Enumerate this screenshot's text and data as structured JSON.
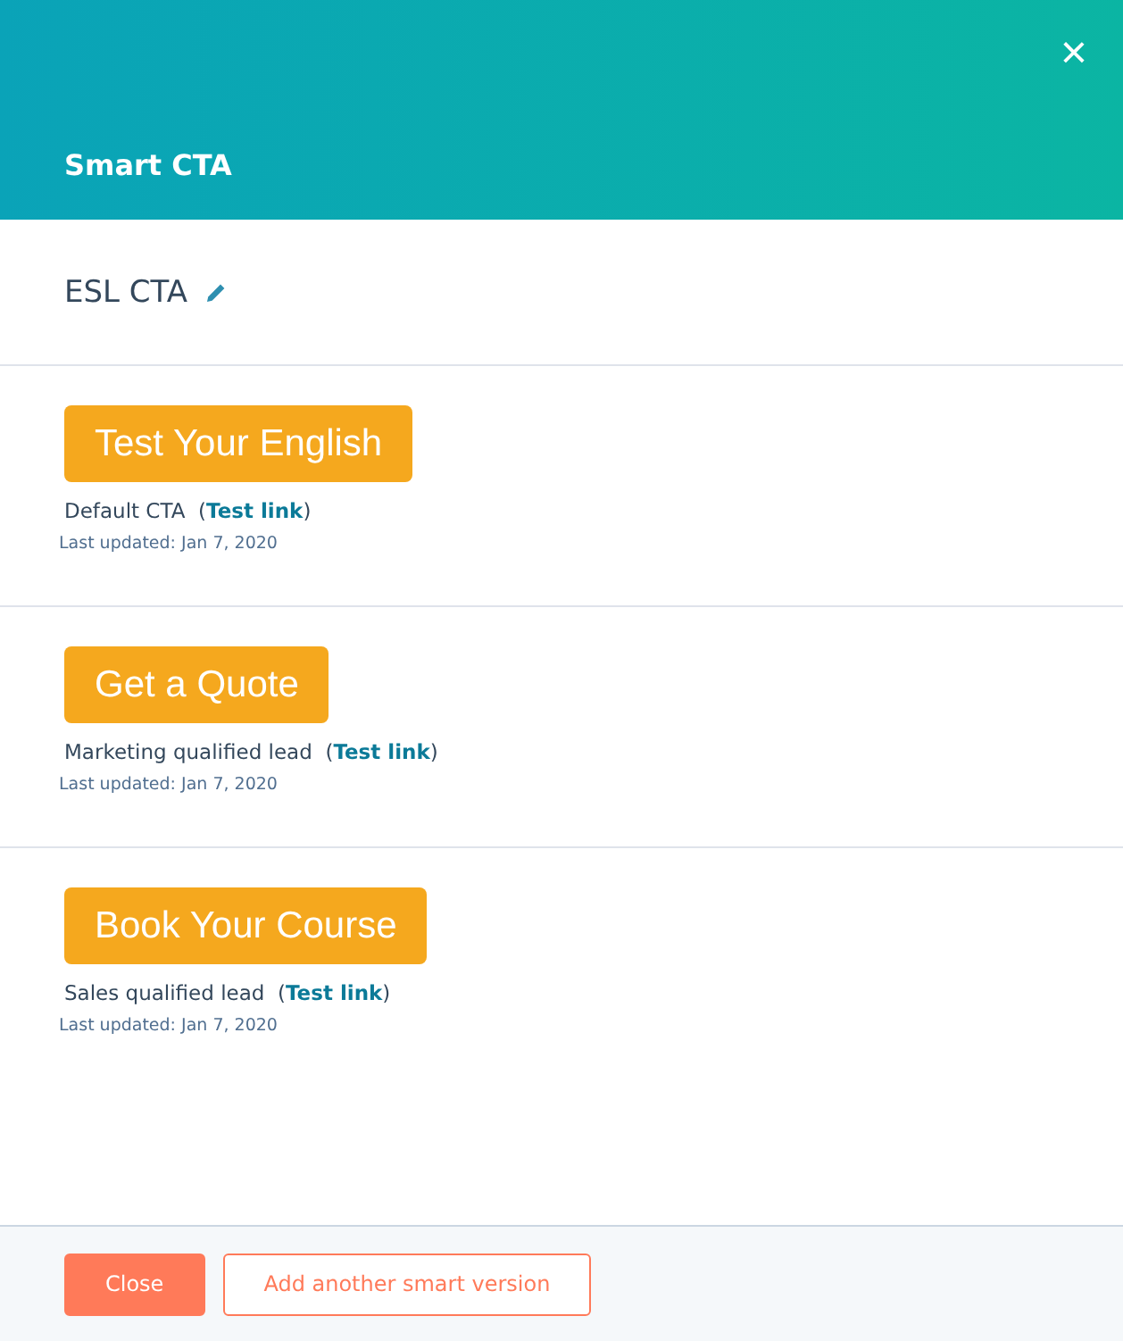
{
  "header": {
    "title": "Smart CTA",
    "close": "×"
  },
  "cta_name": "ESL CTA",
  "versions": [
    {
      "button_label": "Test Your English",
      "audience": "Default CTA  (",
      "link": "Test link",
      "after_link": ")",
      "updated": "Last updated: Jan 7, 2020"
    },
    {
      "button_label": "Get a Quote",
      "audience": "Marketing qualified lead  (",
      "link": "Test link",
      "after_link": ")",
      "updated": "Last updated: Jan 7, 2020"
    },
    {
      "button_label": "Book Your Course",
      "audience": "Sales qualified lead  (",
      "link": "Test link",
      "after_link": ")",
      "updated": "Last updated: Jan 7, 2020"
    }
  ],
  "footer": {
    "buttons": [
      "Close",
      "Add another smart version"
    ]
  }
}
